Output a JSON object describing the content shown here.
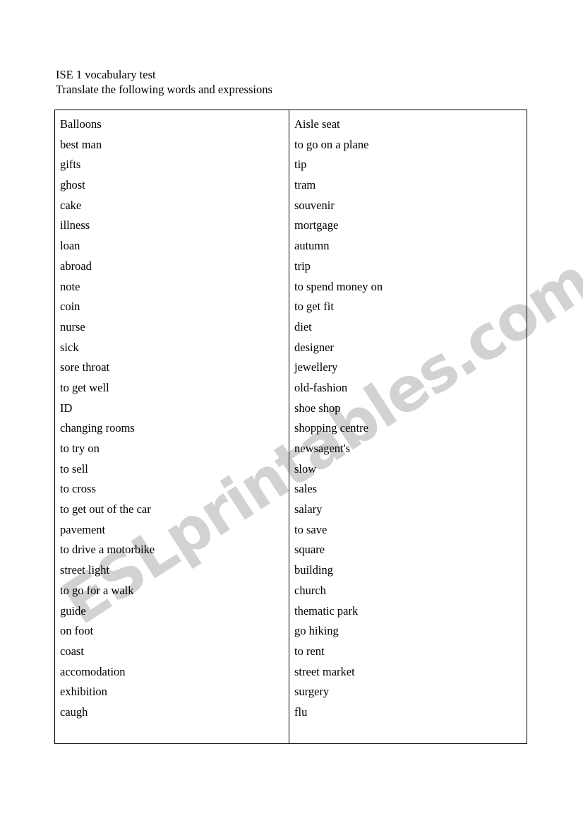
{
  "document": {
    "watermark": "ESLprintables.com",
    "watermark_color": "#d2d2d2",
    "heading_line_1": "ISE 1 vocabulary test",
    "heading_line_2": "Translate the following words and expressions"
  },
  "table": {
    "columns": [
      {
        "name": "left-column",
        "items": [
          "Balloons",
          "best man",
          "gifts",
          "ghost",
          "cake",
          "illness",
          "loan",
          "abroad",
          "note",
          "coin",
          "nurse",
          "sick",
          "sore throat",
          "to get well",
          "ID",
          "changing rooms",
          "to try on",
          "to sell",
          "to cross",
          "to get out of the car",
          "pavement",
          "to drive a motorbike",
          "street light",
          "to go for a walk",
          "guide",
          "on foot",
          "coast",
          "accomodation",
          "exhibition",
          "caugh"
        ]
      },
      {
        "name": "right-column",
        "items": [
          "Aisle seat",
          "to go on a plane",
          "tip",
          "tram",
          "souvenir",
          "mortgage",
          "autumn",
          "trip",
          "to spend money on",
          "to get fit",
          "diet",
          "designer",
          "jewellery",
          "old-fashion",
          "shoe shop",
          "shopping centre",
          "newsagent's",
          "slow",
          "sales",
          "salary",
          "to save",
          "square",
          "building",
          "church",
          "thematic park",
          "go hiking",
          "to rent",
          "street market",
          "surgery",
          "flu"
        ]
      }
    ]
  }
}
